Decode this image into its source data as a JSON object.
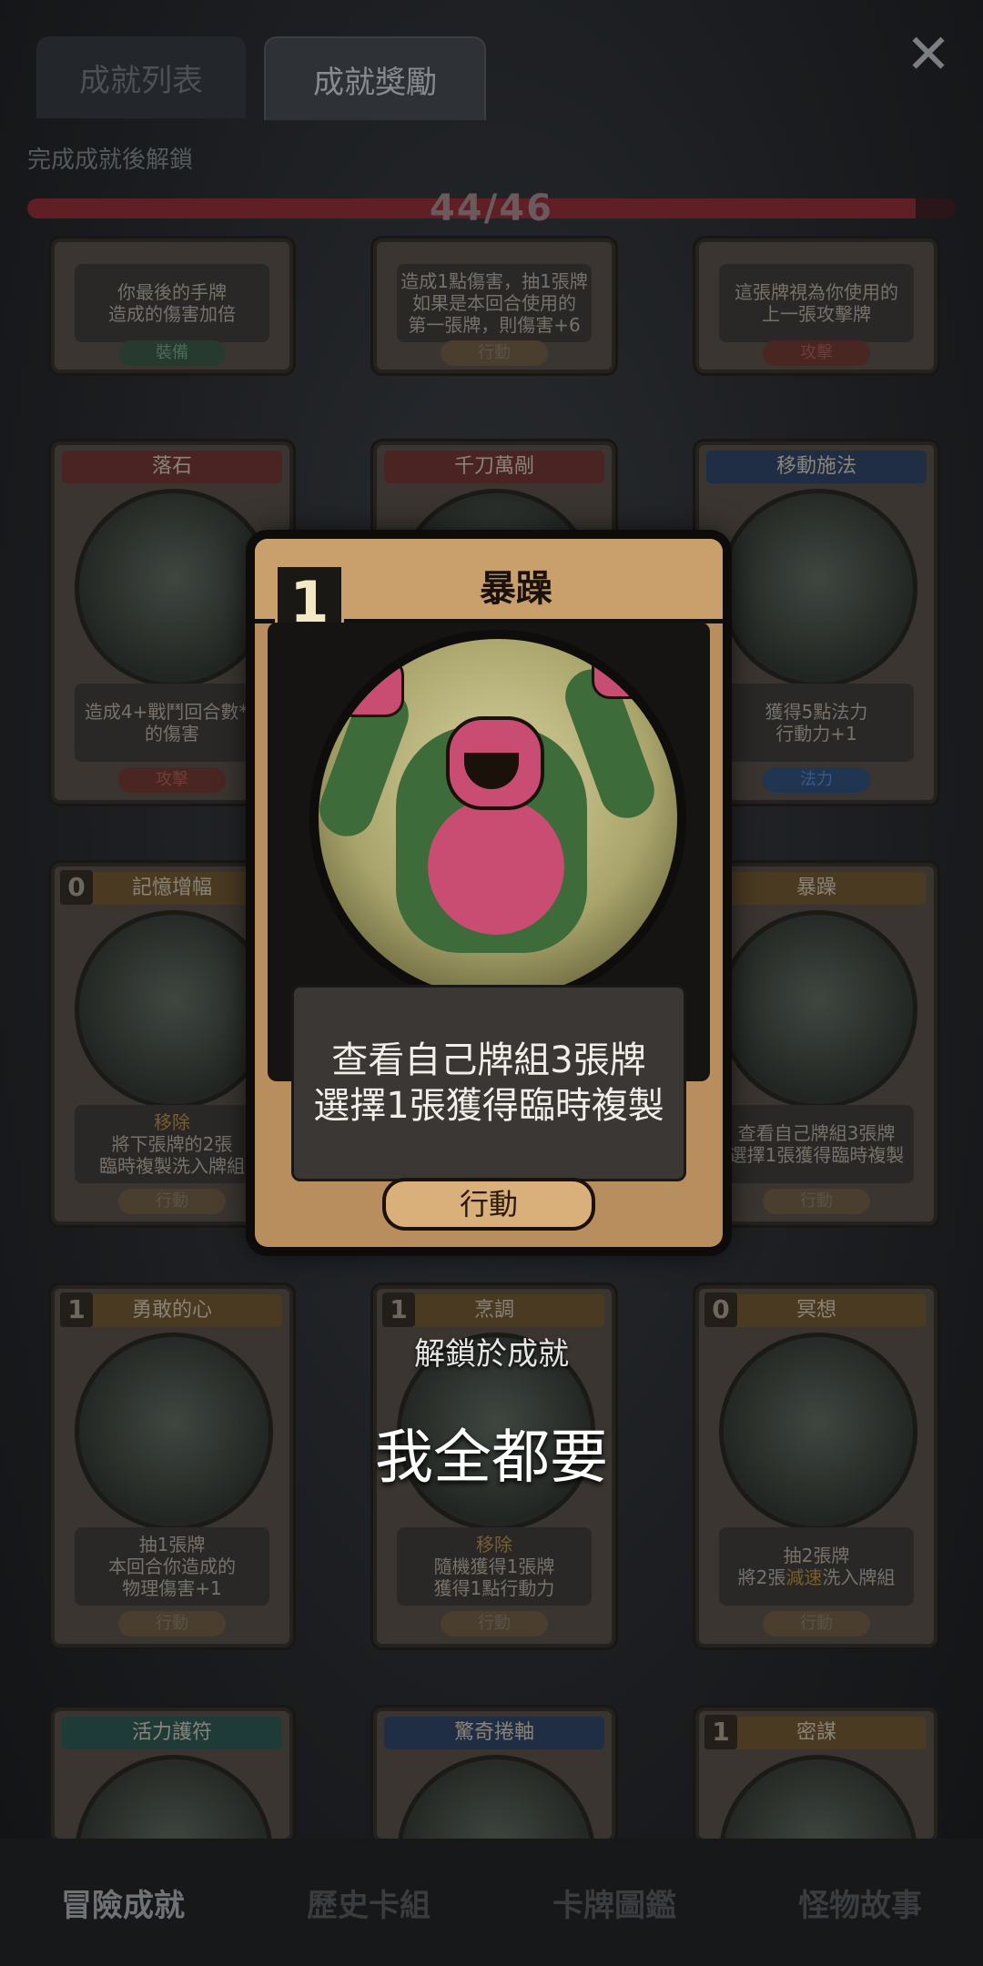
{
  "tabs": {
    "list": "成就列表",
    "reward": "成就獎勵"
  },
  "close_label": "✕",
  "subtitle": "完成成就後解鎖",
  "progress": {
    "text": "44/46",
    "current": 44,
    "total": 46
  },
  "cards": {
    "r0": [
      {
        "desc1": "你最後的手牌",
        "desc2": "造成的傷害加倍",
        "type": "裝備"
      },
      {
        "desc1": "造成1點傷害，抽1張牌",
        "desc2": "如果是本回合使用的",
        "desc3": "第一張牌，則傷害+6",
        "type": "行動"
      },
      {
        "desc1": "這張牌視為你使用的",
        "desc2": "上一張攻擊牌",
        "type": "攻擊"
      }
    ],
    "r1": [
      {
        "name": "落石",
        "desc1": "造成4+戰鬥回合數*1",
        "desc2": "的傷害",
        "type": "攻擊"
      },
      {
        "name": "千刀萬剮"
      },
      {
        "name": "移動施法",
        "desc1": "獲得5點法力",
        "desc2": "行動力+1",
        "type": "法力"
      }
    ],
    "r2": [
      {
        "cost": "0",
        "name": "記憶增幅",
        "kw": "移除",
        "desc1": "將下張牌的2張",
        "desc2": "臨時複製洗入牌組",
        "type": "行動"
      },
      {
        "name": "暴躁",
        "desc1": "查看自己牌組3張牌",
        "desc2": "選擇1張獲得臨時複製",
        "type": "行動"
      }
    ],
    "r3": [
      {
        "cost": "1",
        "name": "勇敢的心",
        "desc1": "抽1張牌",
        "desc2": "本回合你造成的",
        "desc3": "物理傷害+1",
        "type": "行動"
      },
      {
        "cost": "1",
        "name": "烹調",
        "kw": "移除",
        "desc1": "隨機獲得1張牌",
        "desc2": "獲得1點行動力",
        "type": "行動"
      },
      {
        "cost": "0",
        "name": "冥想",
        "desc1": "抽2張牌",
        "desc2a": "將2張",
        "kw": "減速",
        "desc2b": "洗入牌組",
        "type": "行動"
      }
    ],
    "r4": [
      {
        "name": "活力護符"
      },
      {
        "name": "驚奇捲軸"
      },
      {
        "cost": "1",
        "name": "密謀"
      }
    ]
  },
  "hero": {
    "cost": "1",
    "name": "暴躁",
    "line1": "查看自己牌組3張牌",
    "line2": "選擇1張獲得臨時複製",
    "type": "行動"
  },
  "unlock": {
    "label": "解鎖於成就",
    "achievement": "我全都要"
  },
  "nav": [
    "冒險成就",
    "歷史卡組",
    "卡牌圖鑑",
    "怪物故事"
  ]
}
